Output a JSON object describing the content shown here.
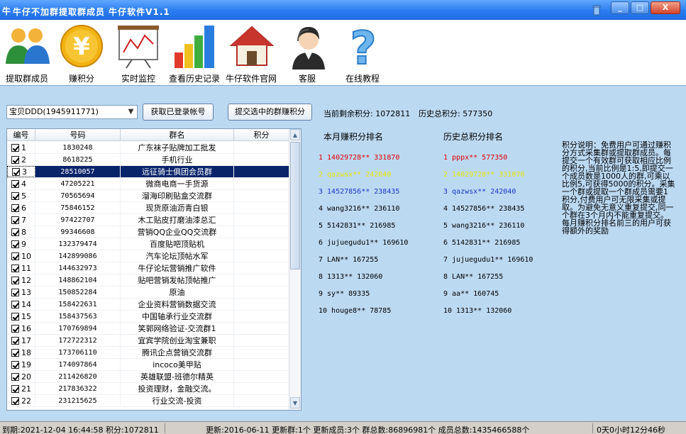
{
  "window": {
    "title": "牛仔不加群提取群成员 牛仔软件V1.1",
    "app_icon_glyph": "牛",
    "controls": [
      "_",
      "□",
      "X"
    ]
  },
  "toolbar": [
    {
      "label": "提取群成员",
      "icon": "users-icon"
    },
    {
      "label": "赚积分",
      "icon": "yen-coin-icon"
    },
    {
      "label": "实时监控",
      "icon": "chart-board-icon"
    },
    {
      "label": "查看历史记录",
      "icon": "bar-chart-icon"
    },
    {
      "label": "牛仔软件官网",
      "icon": "house-icon"
    },
    {
      "label": "客服",
      "icon": "support-agent-icon"
    },
    {
      "label": "在线教程",
      "icon": "help-question-icon"
    }
  ],
  "account": {
    "selected": "宝贝DDD(1945911771)"
  },
  "buttons": {
    "get_logged": "获取已登录帐号",
    "submit_groups": "提交选中的群赚积分"
  },
  "points": {
    "remaining": "当前剩余积分: 1072811",
    "history_total": "历史总积分: 577350"
  },
  "grid": {
    "headers": [
      "编号",
      "号码",
      "群名",
      "积分"
    ],
    "rows": [
      {
        "id": "1",
        "number": "1830248",
        "name": "广东袜子贴牌加工批发",
        "points": ""
      },
      {
        "id": "2",
        "number": "8618225",
        "name": "手机行业",
        "points": ""
      },
      {
        "id": "3",
        "number": "28510057",
        "name": "远征骑士俱团会员群",
        "points": "",
        "selected": true
      },
      {
        "id": "4",
        "number": "47205221",
        "name": "微商电商一手货源",
        "points": ""
      },
      {
        "id": "5",
        "number": "70565694",
        "name": "溜海印刷贴盒交流群",
        "points": ""
      },
      {
        "id": "6",
        "number": "75846152",
        "name": "现货原油沥青白银",
        "points": ""
      },
      {
        "id": "7",
        "number": "97422707",
        "name": "木工贴皮打磨油漆总汇",
        "points": ""
      },
      {
        "id": "8",
        "number": "99346608",
        "name": "营销QQ企业QQ交流群",
        "points": ""
      },
      {
        "id": "9",
        "number": "132379474",
        "name": "百度贴吧顶贴机",
        "points": ""
      },
      {
        "id": "10",
        "number": "142899086",
        "name": "汽车论坛顶帖水军",
        "points": ""
      },
      {
        "id": "11",
        "number": "144632973",
        "name": "牛仔论坛营销推广软件",
        "points": ""
      },
      {
        "id": "12",
        "number": "148862104",
        "name": "贴吧营销发帖顶帖推广",
        "points": ""
      },
      {
        "id": "13",
        "number": "150852284",
        "name": "原油",
        "points": ""
      },
      {
        "id": "14",
        "number": "158422631",
        "name": "企业资料营销数据交流",
        "points": ""
      },
      {
        "id": "15",
        "number": "158437563",
        "name": "中国轴承行业交流群",
        "points": ""
      },
      {
        "id": "16",
        "number": "170769894",
        "name": "笑郭网络验证-交流群1",
        "points": ""
      },
      {
        "id": "17",
        "number": "172722312",
        "name": "宜宾学院创业淘宝兼职",
        "points": ""
      },
      {
        "id": "18",
        "number": "173706110",
        "name": "腾讯企点营销交流群",
        "points": ""
      },
      {
        "id": "19",
        "number": "174097864",
        "name": "incoco美甲贴",
        "points": ""
      },
      {
        "id": "20",
        "number": "211426820",
        "name": "英雄联盟-班德尔精英",
        "points": ""
      },
      {
        "id": "21",
        "number": "217836322",
        "name": "投资理财，金融交流。",
        "points": ""
      },
      {
        "id": "22",
        "number": "231215625",
        "name": "行业交流-投资",
        "points": ""
      }
    ]
  },
  "monthly_rank": {
    "title": "本月赚积分排名",
    "items": [
      {
        "text": "1 14029728** 331870",
        "color": "#e00000"
      },
      {
        "text": "2 qazwsx** 242040",
        "color": "#e6e600"
      },
      {
        "text": "3 14527856** 238435",
        "color": "#1a36c8"
      },
      {
        "text": "4 wang3216** 236110",
        "color": "#000000"
      },
      {
        "text": "5 5142831** 216985",
        "color": "#000000"
      },
      {
        "text": "6 jujuegudu1** 169610",
        "color": "#000000"
      },
      {
        "text": "7 LAN** 167255",
        "color": "#000000"
      },
      {
        "text": "8 1313** 132060",
        "color": "#000000"
      },
      {
        "text": "9 sy** 89335",
        "color": "#000000"
      },
      {
        "text": "10 houge8** 78785",
        "color": "#000000"
      }
    ]
  },
  "history_rank": {
    "title": "历史总积分排名",
    "items": [
      {
        "text": "1 pppx** 577350",
        "color": "#e00000"
      },
      {
        "text": "2 14029728** 331870",
        "color": "#e6e600"
      },
      {
        "text": "3 qazwsx** 242040",
        "color": "#1a36c8"
      },
      {
        "text": "4 14527856** 238435",
        "color": "#000000"
      },
      {
        "text": "5 wang3216** 236110",
        "color": "#000000"
      },
      {
        "text": "6 5142831** 216985",
        "color": "#000000"
      },
      {
        "text": "7 jujuegudu1** 169610",
        "color": "#000000"
      },
      {
        "text": "8 LAN** 167255",
        "color": "#000000"
      },
      {
        "text": "9 aa** 160745",
        "color": "#000000"
      },
      {
        "text": "10 1313** 132060",
        "color": "#000000"
      }
    ]
  },
  "explanation": "积分说明：免费用户可通过赚积分方式采集群或提取群成员。每提交一个有效群可获取相应比例的积分,当前比例是1:5,即提交一个成员数是1000人的群,可乘以比例5,可获得5000的积分。采集一个群或提取一个群成员需要1积分,付费用户可无限采集或提取。为避免无意义重复提交,同一个群在3个月内不能重复提交。每月赚积分排名前三的用户可获得额外的奖励",
  "status": {
    "expiry": "到期:2021-12-04 16:44:58 积分:1072811",
    "update": "更新:2016-06-11 更新群:1个 更新成员:3个 群总数:86896981个 成员总数:1435466588个",
    "elapsed": "0天0小时12分46秒"
  }
}
